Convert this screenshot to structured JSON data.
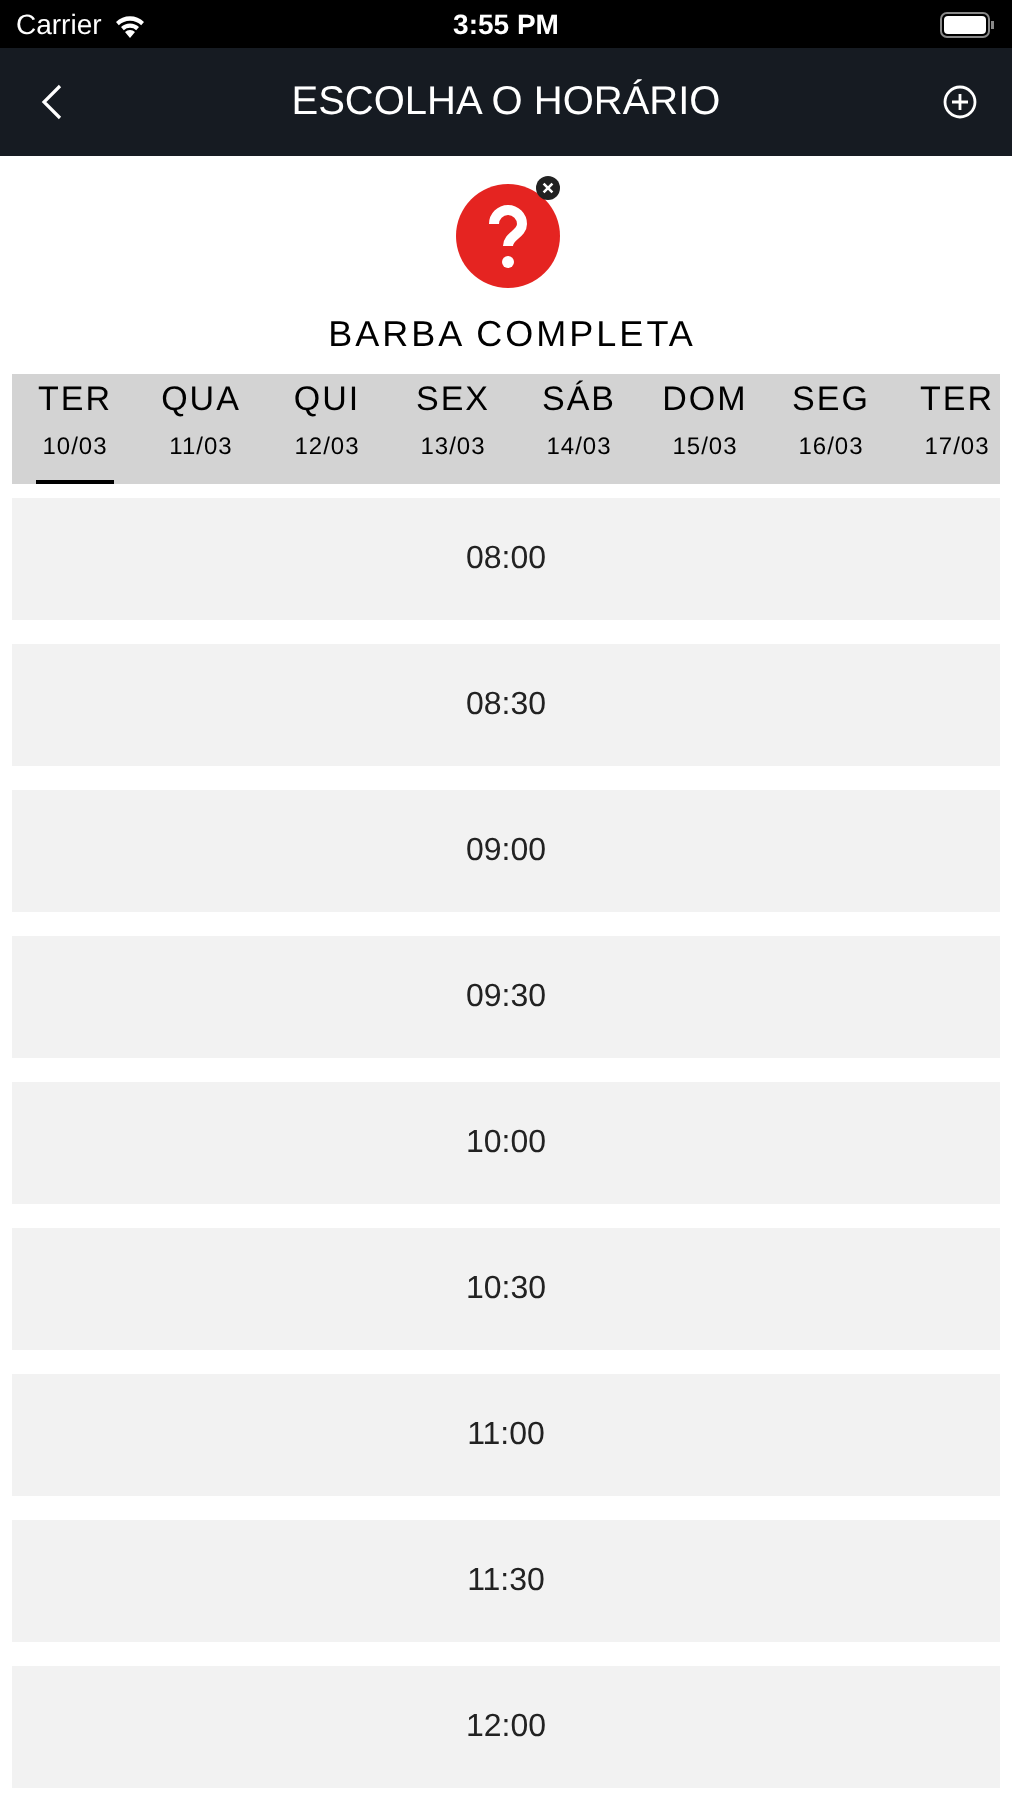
{
  "status_bar": {
    "carrier": "Carrier",
    "time": "3:55 PM"
  },
  "header": {
    "title": "ESCOLHA O HORÁRIO"
  },
  "service": {
    "name": "BARBA COMPLETA"
  },
  "days": [
    {
      "weekday": "TER",
      "date": "10/03",
      "selected": true
    },
    {
      "weekday": "QUA",
      "date": "11/03",
      "selected": false
    },
    {
      "weekday": "QUI",
      "date": "12/03",
      "selected": false
    },
    {
      "weekday": "SEX",
      "date": "13/03",
      "selected": false
    },
    {
      "weekday": "SÁB",
      "date": "14/03",
      "selected": false
    },
    {
      "weekday": "DOM",
      "date": "15/03",
      "selected": false
    },
    {
      "weekday": "SEG",
      "date": "16/03",
      "selected": false
    },
    {
      "weekday": "TER",
      "date": "17/03",
      "selected": false
    }
  ],
  "slots": [
    "08:00",
    "08:30",
    "09:00",
    "09:30",
    "10:00",
    "10:30",
    "11:00",
    "11:30",
    "12:00"
  ]
}
